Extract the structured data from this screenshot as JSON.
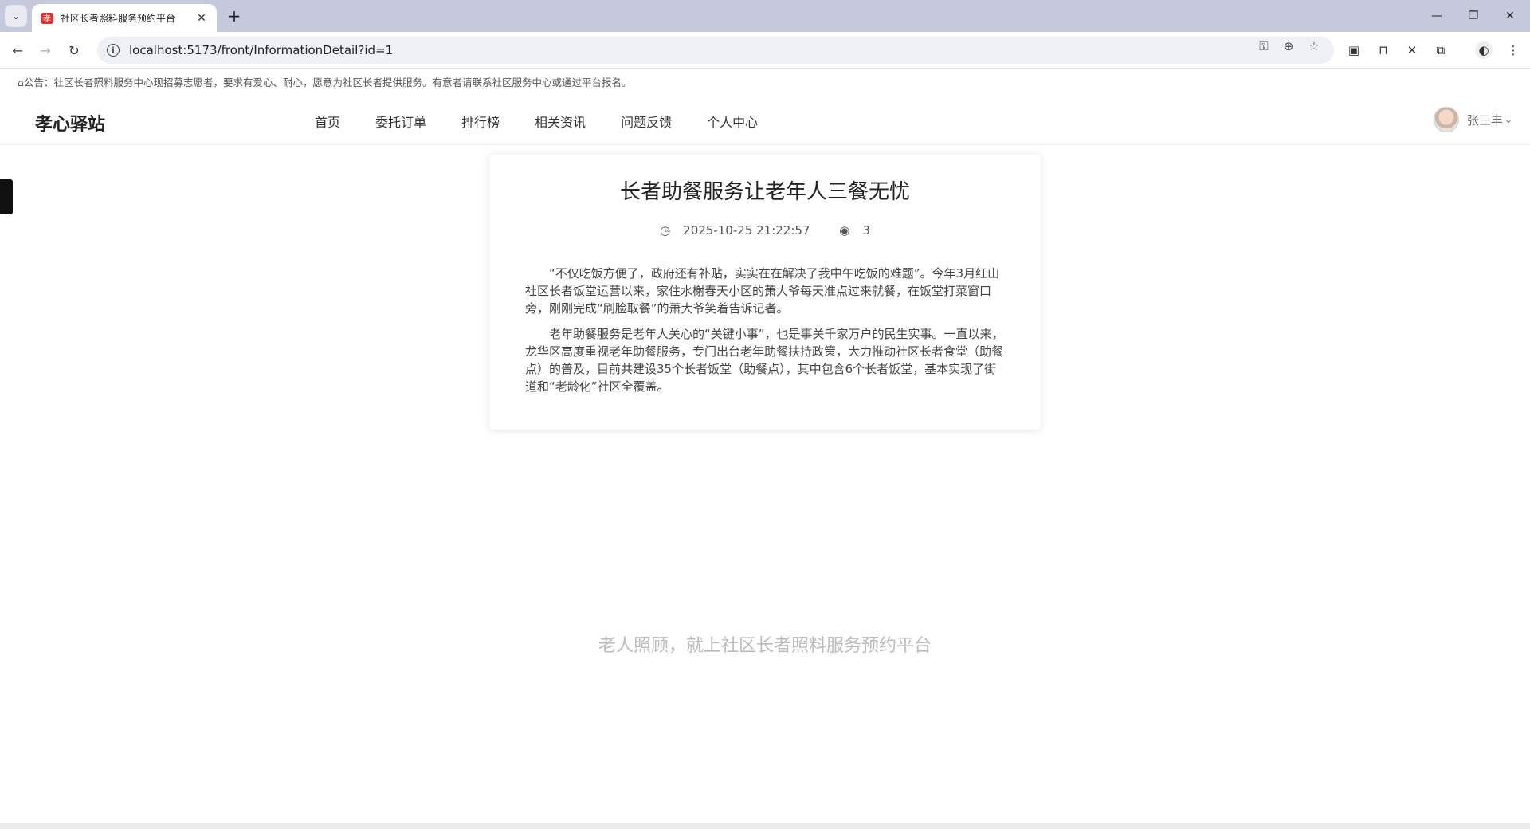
{
  "browser": {
    "tab_title": "社区长者照料服务预约平台",
    "tab_close": "✕",
    "new_tab": "+",
    "url": "localhost:5173/front/InformationDetail?id=1",
    "window": {
      "minimize": "—",
      "restore": "❐",
      "close": "✕"
    }
  },
  "notice": "公告：社区长者照料服务中心现招募志愿者，要求有爱心、耐心，愿意为社区长者提供服务。有意者请联系社区服务中心或通过平台报名。",
  "header": {
    "logo": "孝心驿站",
    "nav": [
      "首页",
      "委托订单",
      "排行榜",
      "相关资讯",
      "问题反馈",
      "个人中心"
    ],
    "username": "张三丰"
  },
  "article": {
    "title": "长者助餐服务让老年人三餐无忧",
    "date": "2025-10-25 21:22:57",
    "views": "3",
    "paragraphs": [
      "“不仅吃饭方便了，政府还有补贴，实实在在解决了我中午吃饭的难题”。今年3月红山社区长者饭堂运营以来，家住水榭春天小区的萧大爷每天准点过来就餐，在饭堂打菜窗口旁，刚刚完成“刷脸取餐”的萧大爷笑着告诉记者。",
      "老年助餐服务是老年人关心的“关键小事”，也是事关千家万户的民生实事。一直以来，龙华区高度重视老年助餐服务，专门出台老年助餐扶持政策，大力推动社区长者食堂（助餐点）的普及，目前共建设35个长者饭堂（助餐点），其中包含6个长者饭堂，基本实现了街道和“老龄化”社区全覆盖。"
    ]
  },
  "footer_slogan": "老人照顾，就上社区长者照料服务预约平台"
}
